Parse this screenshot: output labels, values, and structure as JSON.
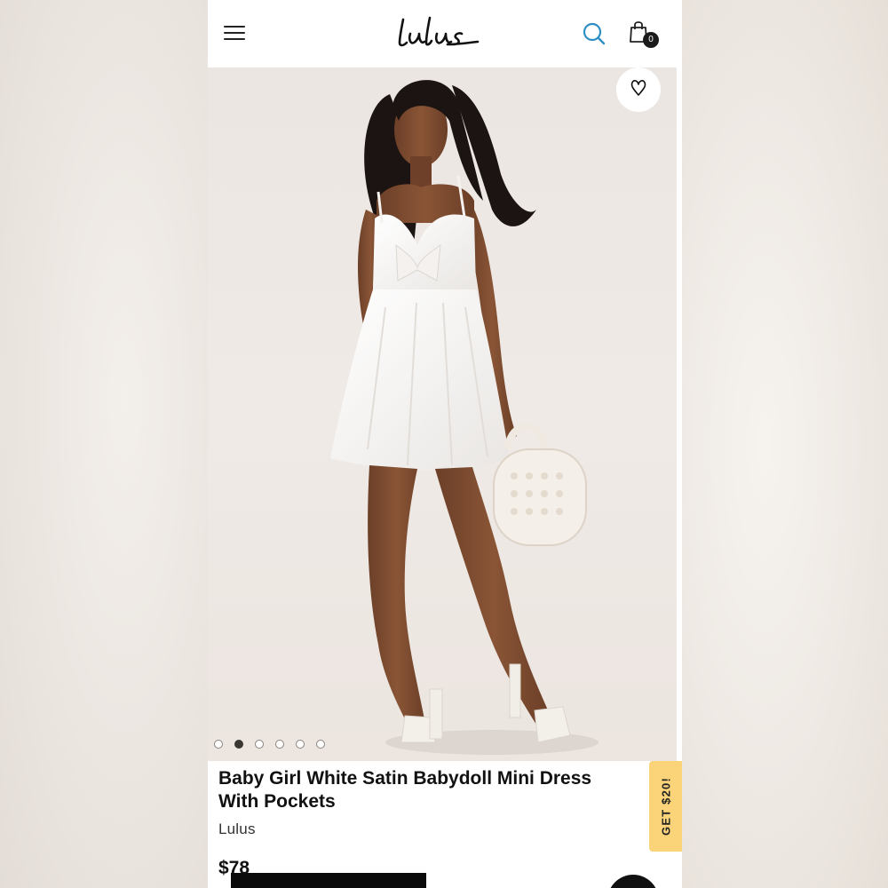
{
  "header": {
    "brand": "Lulus",
    "cart_count": "0"
  },
  "gallery": {
    "dots": [
      {
        "active": false
      },
      {
        "active": true
      },
      {
        "active": false
      },
      {
        "active": false
      },
      {
        "active": false
      },
      {
        "active": false
      }
    ]
  },
  "product": {
    "title": "Baby Girl White Satin Babydoll Mini Dress With Pockets",
    "brand": "Lulus",
    "price": "$78"
  },
  "promo": {
    "label": "GET $20!"
  },
  "colors": {
    "accent_search": "#2f8fc4",
    "promo_bg": "#fbd47a",
    "text": "#111111"
  },
  "icons": [
    "menu-icon",
    "search-icon",
    "bag-icon",
    "heart-icon"
  ]
}
